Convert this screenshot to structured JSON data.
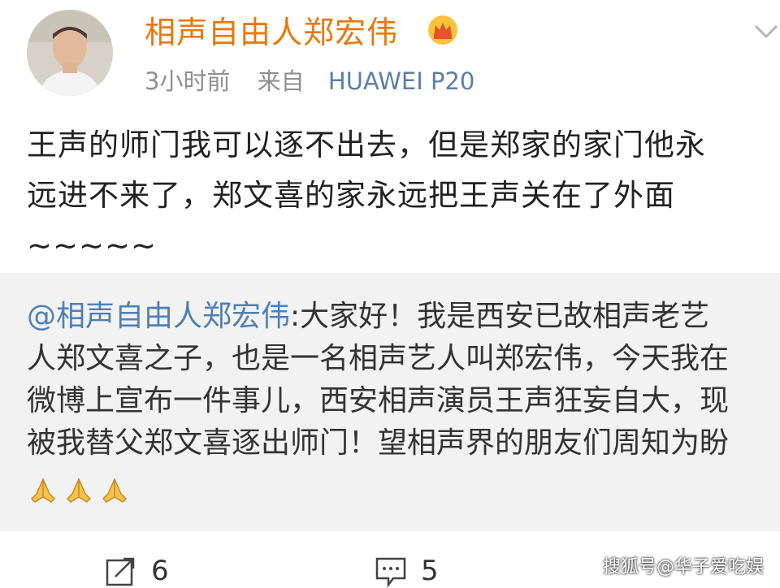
{
  "header": {
    "username": "相声自由人郑宏伟",
    "time": "3小时前",
    "source_prefix": "来自",
    "device": "HUAWEI P20",
    "icons": {
      "crown": "crown-icon",
      "more": "chevron-down-icon"
    },
    "colors": {
      "username": "#e8780b",
      "meta": "#8f8f8f",
      "device": "#5b7fa6"
    }
  },
  "post": {
    "lines": [
      "王声的师门我可以逐不出去，但是郑家的家门他永",
      "远进不来了，郑文喜的家永远把王声关在了外面",
      "~~~~~"
    ]
  },
  "quote": {
    "mention": "@相声自由人郑宏伟",
    "lines": [
      ":大家好！我是西安已故相声老艺",
      "人郑文喜之子，也是一名相声艺人叫郑宏伟，今天我在",
      "微博上宣布一件事儿，西安相声演员王声狂妄自大，现",
      "被我替父郑文喜逐出师门！望相声界的朋友们周知为盼"
    ],
    "emoji": [
      "praying-hands-icon",
      "praying-hands-icon",
      "praying-hands-icon"
    ],
    "colors": {
      "mention": "#4f7fb6",
      "background": "#f2f2f2"
    }
  },
  "actions": {
    "repost_count": "6",
    "comment_count": "5",
    "icons": {
      "repost": "repost-icon",
      "comment": "comment-icon"
    }
  },
  "watermark": "搜狐号@华子爱吃娱"
}
